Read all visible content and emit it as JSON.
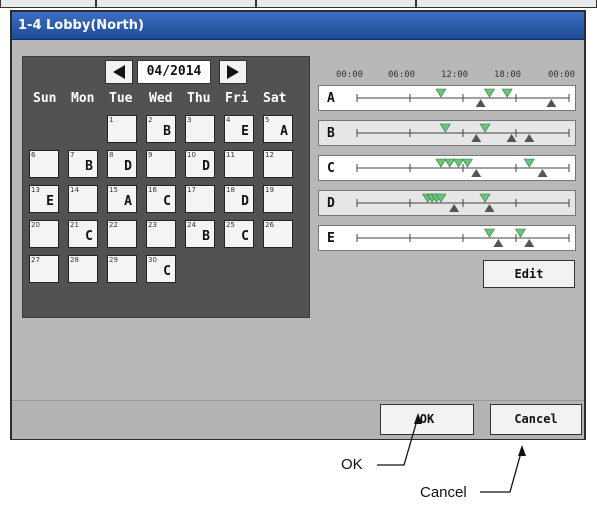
{
  "window": {
    "title": "1-4 Lobby(North)"
  },
  "calendar": {
    "month": "04/2014",
    "weekdays": [
      "Sun",
      "Mon",
      "Tue",
      "Wed",
      "Thu",
      "Fri",
      "Sat"
    ],
    "days": [
      {
        "d": "1",
        "p": ""
      },
      {
        "d": "2",
        "p": "B"
      },
      {
        "d": "3",
        "p": ""
      },
      {
        "d": "4",
        "p": "E"
      },
      {
        "d": "5",
        "p": "A"
      },
      {
        "d": "6",
        "p": ""
      },
      {
        "d": "7",
        "p": "B"
      },
      {
        "d": "8",
        "p": "D"
      },
      {
        "d": "9",
        "p": ""
      },
      {
        "d": "10",
        "p": "D"
      },
      {
        "d": "11",
        "p": ""
      },
      {
        "d": "12",
        "p": ""
      },
      {
        "d": "13",
        "p": "E"
      },
      {
        "d": "14",
        "p": ""
      },
      {
        "d": "15",
        "p": "A"
      },
      {
        "d": "16",
        "p": "C"
      },
      {
        "d": "17",
        "p": ""
      },
      {
        "d": "18",
        "p": "D"
      },
      {
        "d": "19",
        "p": ""
      },
      {
        "d": "20",
        "p": ""
      },
      {
        "d": "21",
        "p": "C"
      },
      {
        "d": "22",
        "p": ""
      },
      {
        "d": "23",
        "p": ""
      },
      {
        "d": "24",
        "p": "B"
      },
      {
        "d": "25",
        "p": "C"
      },
      {
        "d": "26",
        "p": ""
      },
      {
        "d": "27",
        "p": ""
      },
      {
        "d": "28",
        "p": ""
      },
      {
        "d": "29",
        "p": ""
      },
      {
        "d": "30",
        "p": "C"
      }
    ]
  },
  "patterns": {
    "time_labels": [
      "00:00",
      "06:00",
      "12:00",
      "18:00",
      "00:00"
    ],
    "rows": [
      {
        "label": "A",
        "on": [
          9.5,
          15.0,
          17.0
        ],
        "off": [
          14.0,
          22.0
        ]
      },
      {
        "label": "B",
        "on": [
          10.0,
          14.5
        ],
        "off": [
          13.5,
          17.5,
          19.5
        ]
      },
      {
        "label": "C",
        "on": [
          9.5,
          10.5,
          11.5,
          12.5,
          19.5
        ],
        "off": [
          13.5,
          21.0
        ]
      },
      {
        "label": "D",
        "on": [
          8.0,
          8.5,
          9.0,
          9.5,
          14.5
        ],
        "off": [
          11.0,
          15.0
        ]
      },
      {
        "label": "E",
        "on": [
          15.0,
          18.5
        ],
        "off": [
          16.0,
          19.5
        ]
      }
    ]
  },
  "buttons": {
    "edit": "Edit",
    "ok": "OK",
    "cancel": "Cancel"
  },
  "callouts": {
    "ok": "OK",
    "cancel": "Cancel"
  },
  "colors": {
    "titlebar": "#2a5aab",
    "on_marker": "#6cc37a",
    "off_marker": "#555555",
    "panel": "#525252"
  }
}
